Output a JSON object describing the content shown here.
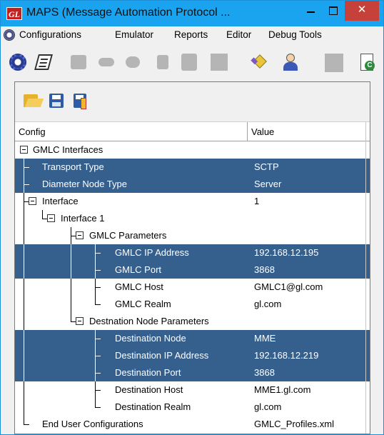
{
  "window": {
    "title": "MAPS (Message Automation Protocol ...",
    "logo_text": "GL",
    "close_glyph": "✕"
  },
  "menu": {
    "items": [
      {
        "label": "Configurations"
      },
      {
        "label": "Emulator"
      },
      {
        "label": "Reports"
      },
      {
        "label": "Editor"
      },
      {
        "label": "Debug Tools"
      }
    ]
  },
  "toolbar": {
    "icons": [
      "settings-gear-icon",
      "script-icon",
      "call-icon",
      "phone-icon",
      "phone-icon",
      "call-icon",
      "cell-icon",
      "blank-icon",
      "edit-icon",
      "user-icon",
      "blank-icon",
      "report-icon"
    ],
    "report_badge": "C"
  },
  "panel_toolbar": {
    "icons": [
      "open-folder-icon",
      "save-icon",
      "save-as-icon"
    ]
  },
  "grid": {
    "headers": {
      "config": "Config",
      "value": "Value"
    },
    "rows": [
      {
        "label": "GMLC Interfaces",
        "value": ""
      },
      {
        "label": "Transport Type",
        "value": "SCTP"
      },
      {
        "label": "Diameter Node Type",
        "value": "Server"
      },
      {
        "label": "Interface",
        "value": "1"
      },
      {
        "label": "Interface 1",
        "value": ""
      },
      {
        "label": "GMLC Parameters",
        "value": ""
      },
      {
        "label": "GMLC IP Address",
        "value": "192.168.12.195"
      },
      {
        "label": "GMLC Port",
        "value": "3868"
      },
      {
        "label": "GMLC Host",
        "value": "GMLC1@gl.com"
      },
      {
        "label": "GMLC Realm",
        "value": "gl.com"
      },
      {
        "label": "Destnation Node Parameters",
        "value": ""
      },
      {
        "label": "Destination Node",
        "value": "MME"
      },
      {
        "label": "Destination IP Address",
        "value": "192.168.12.219"
      },
      {
        "label": "Destination Port",
        "value": "3868"
      },
      {
        "label": "Destination Host",
        "value": "MME1.gl.com"
      },
      {
        "label": "Destination Realm",
        "value": "gl.com"
      },
      {
        "label": "End User Configurations",
        "value": "GMLC_Profiles.xml"
      }
    ]
  },
  "colors": {
    "title_bar": "#1aa3ef",
    "selection": "#355f8c",
    "close_button": "#c7413b"
  }
}
